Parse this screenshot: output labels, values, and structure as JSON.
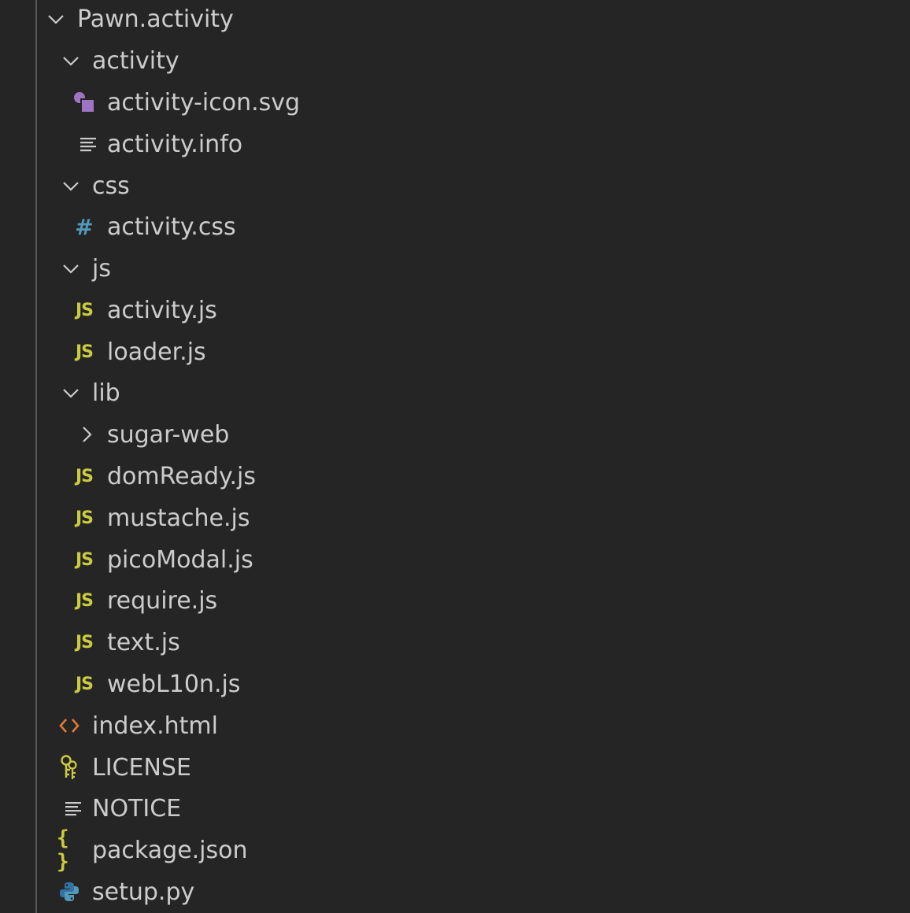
{
  "explorer": {
    "items": [
      {
        "label": "Pawn.activity",
        "icon": "chevron-down-icon"
      },
      {
        "label": "activity",
        "icon": "chevron-down-icon"
      },
      {
        "label": "activity-icon.svg",
        "icon": "svg-file-icon"
      },
      {
        "label": "activity.info",
        "icon": "text-file-icon"
      },
      {
        "label": "css",
        "icon": "chevron-down-icon"
      },
      {
        "label": "activity.css",
        "icon": "css-file-icon"
      },
      {
        "label": "js",
        "icon": "chevron-down-icon"
      },
      {
        "label": "activity.js",
        "icon": "js-file-icon"
      },
      {
        "label": "loader.js",
        "icon": "js-file-icon"
      },
      {
        "label": "lib",
        "icon": "chevron-down-icon"
      },
      {
        "label": "sugar-web",
        "icon": "chevron-right-icon"
      },
      {
        "label": "domReady.js",
        "icon": "js-file-icon"
      },
      {
        "label": "mustache.js",
        "icon": "js-file-icon"
      },
      {
        "label": "picoModal.js",
        "icon": "js-file-icon"
      },
      {
        "label": "require.js",
        "icon": "js-file-icon"
      },
      {
        "label": "text.js",
        "icon": "js-file-icon"
      },
      {
        "label": "webL10n.js",
        "icon": "js-file-icon"
      },
      {
        "label": "index.html",
        "icon": "html-file-icon"
      },
      {
        "label": "LICENSE",
        "icon": "license-file-icon"
      },
      {
        "label": "NOTICE",
        "icon": "text-file-icon"
      },
      {
        "label": "package.json",
        "icon": "json-file-icon"
      },
      {
        "label": "setup.py",
        "icon": "python-file-icon"
      }
    ],
    "icon_text": {
      "js": "JS",
      "css": "#",
      "json": "{ }"
    },
    "colors": {
      "background": "#252526",
      "text": "#cccccc",
      "js": "#cbcb41",
      "css": "#519aba",
      "svg": "#a074c4",
      "html": "#e37933",
      "python_blue": "#3572a5",
      "python_yellow": "#ffd43b"
    }
  }
}
